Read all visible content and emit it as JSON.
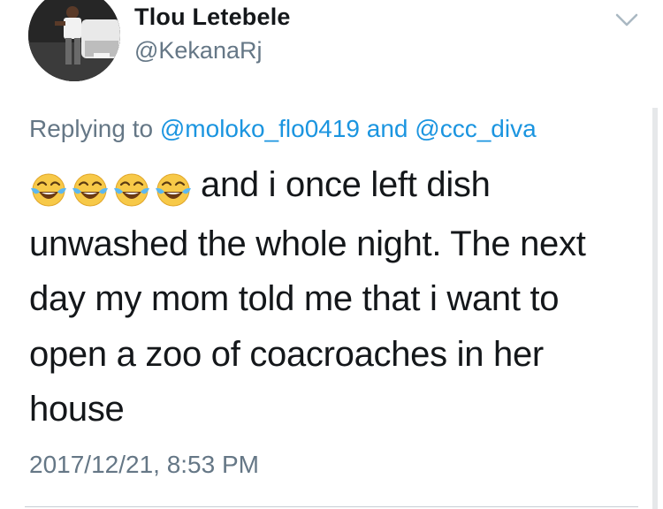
{
  "tweet": {
    "display_name": "Tlou Letebele",
    "handle": "@KekanaRj",
    "replying_prefix": "Replying to",
    "reply_mention_1": "@moloko_flo0419",
    "reply_conjunction": "and",
    "reply_mention_2": "@ccc_diva",
    "emojis": [
      "face-with-tears-of-joy-icon",
      "face-with-tears-of-joy-icon",
      "face-with-tears-of-joy-icon",
      "face-with-tears-of-joy-icon"
    ],
    "body_text": "and i once left dish unwashed the whole night. The next day my mom told me that i want to open a zoo of coacroaches in her house",
    "timestamp": "2017/12/21, 8:53 PM"
  },
  "colors": {
    "text_primary": "#14171a",
    "text_secondary": "#657786",
    "link": "#1b95e0"
  }
}
